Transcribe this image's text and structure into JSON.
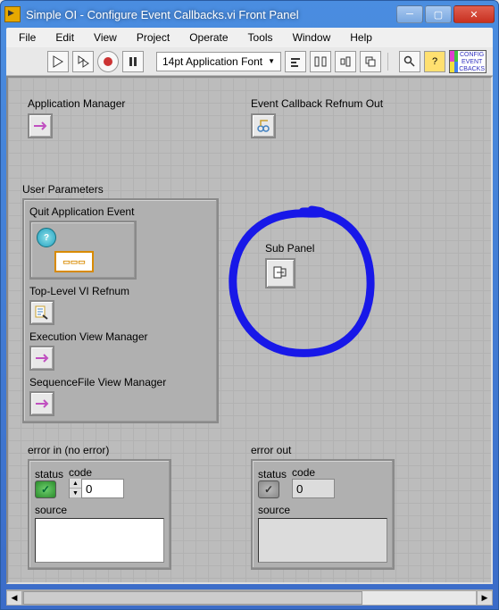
{
  "window": {
    "title": "Simple OI - Configure Event Callbacks.vi Front Panel"
  },
  "menu": {
    "file": "File",
    "edit": "Edit",
    "view": "View",
    "project": "Project",
    "operate": "Operate",
    "tools": "Tools",
    "window": "Window",
    "help": "Help"
  },
  "toolbar": {
    "font": "14pt Application Font",
    "badge": "CONFIG EVENT CBACKS"
  },
  "labels": {
    "app_manager": "Application Manager",
    "event_cb_refnum": "Event Callback Refnum Out",
    "user_params": "User Parameters",
    "quit_app_event": "Quit Application Event",
    "top_vi_refnum": "Top-Level VI Refnum",
    "exec_view_mgr": "Execution View Manager",
    "seqfile_view_mgr": "SequenceFile View Manager",
    "sub_panel": "Sub Panel"
  },
  "error_in": {
    "title": "error in (no error)",
    "status_label": "status",
    "code_label": "code",
    "code_value": "0",
    "source_label": "source",
    "source_value": ""
  },
  "error_out": {
    "title": "error out",
    "status_label": "status",
    "code_label": "code",
    "code_value": "0",
    "source_label": "source",
    "source_value": ""
  }
}
